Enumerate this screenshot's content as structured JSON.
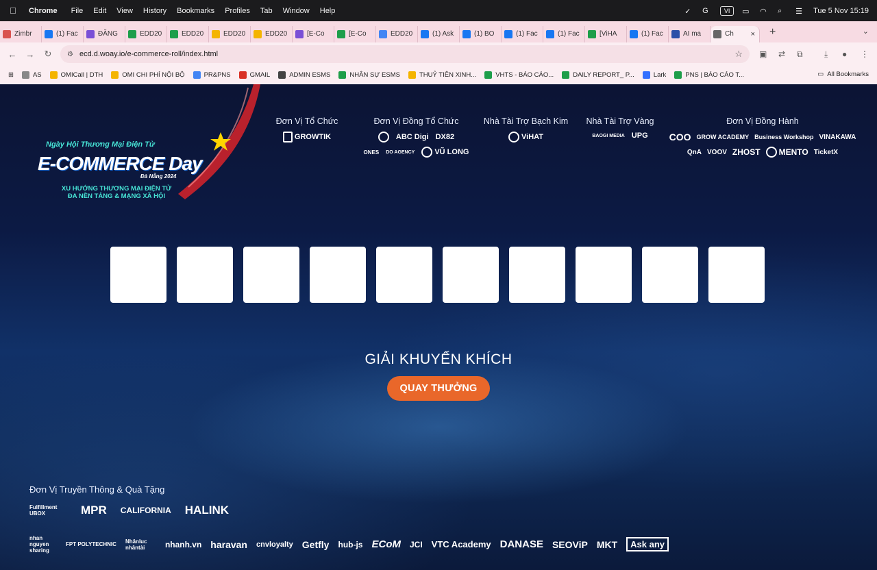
{
  "menubar": {
    "app_name": "Chrome",
    "items": [
      "File",
      "Edit",
      "View",
      "History",
      "Bookmarks",
      "Profiles",
      "Tab",
      "Window",
      "Help"
    ],
    "input_indicator": "VI",
    "datetime": "Tue 5 Nov  15:19"
  },
  "tabs": [
    {
      "label": "Zimbr",
      "color": "#d9534f"
    },
    {
      "label": "(1) Fac",
      "color": "#1877f2"
    },
    {
      "label": "ĐĂNG",
      "color": "#7a4fd6"
    },
    {
      "label": "EDD20",
      "color": "#1e9e4a"
    },
    {
      "label": "EDD20",
      "color": "#1e9e4a"
    },
    {
      "label": "EDD20",
      "color": "#f4b400"
    },
    {
      "label": "EDD20",
      "color": "#f4b400"
    },
    {
      "label": "[E-Co",
      "color": "#7a4fd6"
    },
    {
      "label": "[E-Co",
      "color": "#1e9e4a"
    },
    {
      "label": "EDD20",
      "color": "#4285f4"
    },
    {
      "label": "(1) Ask",
      "color": "#1877f2"
    },
    {
      "label": "(1) BO",
      "color": "#1877f2"
    },
    {
      "label": "(1) Fac",
      "color": "#1877f2"
    },
    {
      "label": "(1) Fac",
      "color": "#1877f2"
    },
    {
      "label": "[ViHA",
      "color": "#1e9e4a"
    },
    {
      "label": "(1) Fac",
      "color": "#1877f2"
    },
    {
      "label": "AI ma",
      "color": "#2b4fa8"
    },
    {
      "label": "Ch",
      "color": "#666666",
      "active": true
    }
  ],
  "tab_close": "×",
  "new_tab": "+",
  "toolbar": {
    "url": "ecd.d.woay.io/e-commerce-roll/index.html"
  },
  "bookmarks": [
    {
      "label": "AS",
      "color": "#888888"
    },
    {
      "label": "OMICall | DTH",
      "color": "#f4b400"
    },
    {
      "label": "OMI CHI PHÍ NỘI BỘ",
      "color": "#f4b400"
    },
    {
      "label": "PR&PNS",
      "color": "#4285f4"
    },
    {
      "label": "GMAIL",
      "color": "#d93025"
    },
    {
      "label": "ADMIN ESMS",
      "color": "#444444"
    },
    {
      "label": "NHÂN SỰ ESMS",
      "color": "#1e9e4a"
    },
    {
      "label": "THUỶ TIÊN XINH...",
      "color": "#f4b400"
    },
    {
      "label": "VHTS - BÁO CÁO...",
      "color": "#1e9e4a"
    },
    {
      "label": "DAILY REPORT_ P...",
      "color": "#1e9e4a"
    },
    {
      "label": "Lark",
      "color": "#3370ff"
    },
    {
      "label": "PNS | BÁO CÁO T...",
      "color": "#1e9e4a"
    }
  ],
  "all_bookmarks": "All Bookmarks",
  "event": {
    "tagline": "Ngày Hội Thương Mại Điện Tử",
    "name": "E-COMMERCE Day",
    "city": "Đà Nẵng 2024",
    "subtitle_1": "XU HƯỚNG THƯƠNG MẠI ĐIỆN TỬ",
    "subtitle_2": "ĐA NỀN TẢNG & MẠNG XÃ HỘI"
  },
  "sponsors": {
    "organizer": {
      "title": "Đơn Vị Tổ Chức",
      "logos": [
        "GROWTIK"
      ]
    },
    "co_organizer": {
      "title": "Đơn Vị Đồng Tổ Chức",
      "logos_row1": [
        "ABC Digi",
        "DX82"
      ],
      "logos_row2": [
        "ONES",
        "DO AGENCY",
        "VŨ LONG"
      ]
    },
    "platinum": {
      "title": "Nhà Tài Trợ Bạch Kim",
      "logos": [
        "ViHAT"
      ]
    },
    "gold": {
      "title": "Nhà Tài Trợ Vàng",
      "logos": [
        "BAOGI MEDIA",
        "UPG"
      ]
    },
    "companion": {
      "title": "Đơn Vị Đồng Hành",
      "logos_row1": [
        "COO",
        "GROW ACADEMY",
        "Business Workshop",
        "VINAKAWA"
      ],
      "logos_row2": [
        "QnA",
        "VOOV",
        "ZHOST",
        "MENTO",
        "TicketX"
      ]
    }
  },
  "roll": {
    "slot_count": 10,
    "prize_title": "GIẢI KHUYẾN KHÍCH",
    "spin_label": "QUAY THƯỞNG",
    "spin_color": "#e9672a"
  },
  "media": {
    "title": "Đơn Vị Truyền Thông & Quà Tặng",
    "row1": [
      "Fulfillment UBOX",
      "MPR",
      "CALIFORNIA",
      "HALINK"
    ],
    "row2": [
      "nhan nguyen sharing",
      "FPT POLYTECHNIC",
      "Nhânluc nhântài",
      "nhanh.vn",
      "haravan",
      "cnvloyalty",
      "Getfly",
      "hub-js",
      "ECoM",
      "JCI",
      "VTC Academy",
      "DANASE",
      "SEOViP",
      "MKT",
      "Ask any"
    ]
  }
}
